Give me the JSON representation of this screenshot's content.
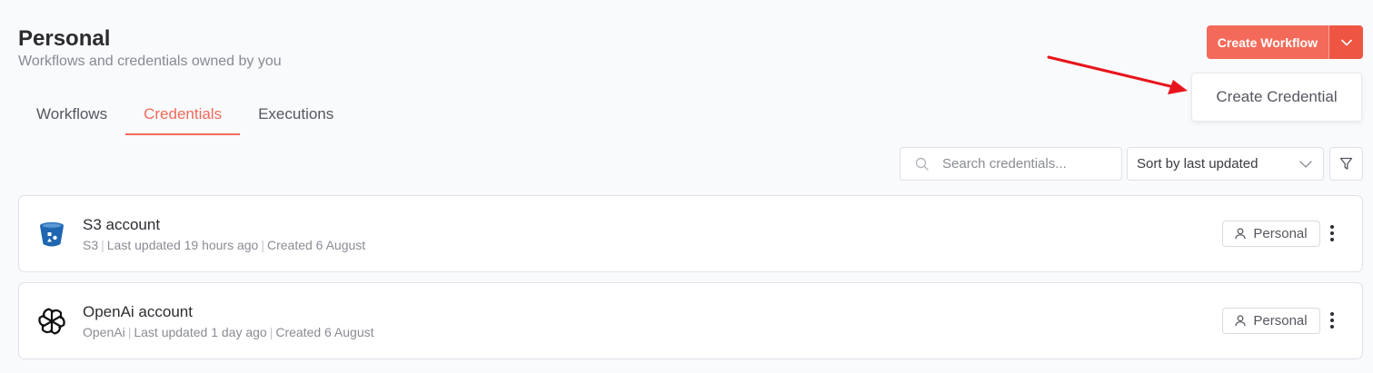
{
  "header": {
    "title": "Personal",
    "subtitle": "Workflows and credentials owned by you"
  },
  "actions": {
    "create_label": "Create Workflow",
    "dropdown_item": "Create Credential"
  },
  "tabs": [
    {
      "label": "Workflows",
      "active": false
    },
    {
      "label": "Credentials",
      "active": true
    },
    {
      "label": "Executions",
      "active": false
    }
  ],
  "toolbar": {
    "search_placeholder": "Search credentials...",
    "sort_label": "Sort by last updated"
  },
  "credentials": [
    {
      "name": "S3 account",
      "type": "S3",
      "updated": "Last updated 19 hours ago",
      "created": "Created 6 August",
      "owner": "Personal",
      "icon": "s3-bucket-icon"
    },
    {
      "name": "OpenAi account",
      "type": "OpenAi",
      "updated": "Last updated 1 day ago",
      "created": "Created 6 August",
      "owner": "Personal",
      "icon": "openai-icon"
    }
  ],
  "colors": {
    "accent": "#f36a5a",
    "accent_dark": "#ef5543",
    "annotation_arrow": "#e8141c"
  }
}
